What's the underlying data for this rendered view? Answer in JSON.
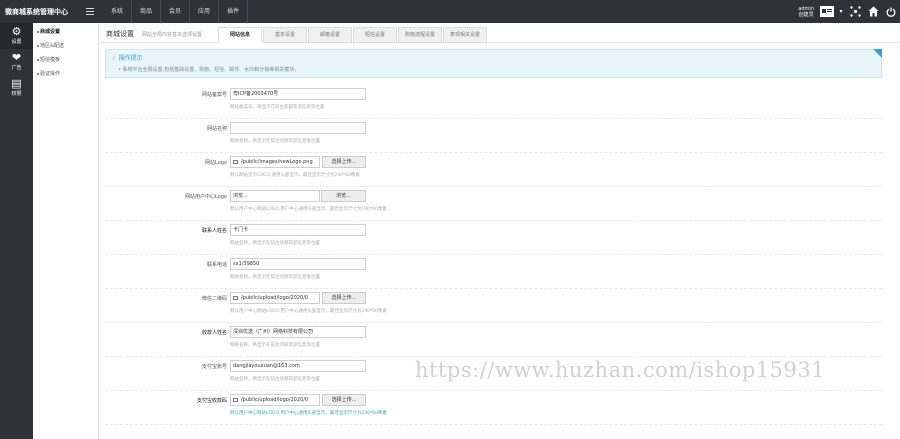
{
  "app": {
    "title": "微商城系统管理中心"
  },
  "topnav": [
    "系统",
    "商品",
    "会员",
    "应用",
    "插件"
  ],
  "user": {
    "name": "admin",
    "role": "创建员"
  },
  "sidebar": [
    {
      "label": "设置",
      "icon": "gear-icon"
    },
    {
      "label": "广告",
      "icon": "heart-icon"
    },
    {
      "label": "权限",
      "icon": "monitor-icon"
    }
  ],
  "subsidebar": [
    "商城设置",
    "地区&配送",
    "短信模板",
    "验证操作"
  ],
  "page": {
    "title": "商城设置",
    "subtitle": "网站全局内容基本选项设置"
  },
  "tabs": [
    "网站信息",
    "基本设置",
    "邮箱设置",
    "短信设置",
    "购物流程设置",
    "表现相关设置"
  ],
  "tip": {
    "title": "操作提示",
    "text": "• 系统平台全局设置,包括基础设置、购物、短信、邮件、水印和分销等相关模块。"
  },
  "form": [
    {
      "label": "网站备案号",
      "value": "粤ICP备2003470号",
      "help": "网站备案号，将显示在前台底部欢迎信息等位置"
    },
    {
      "label": "网站名称",
      "value": "",
      "help": "网站名称，将显示在前台顶部欢迎信息等位置"
    },
    {
      "label": "网站Logo",
      "value": "/public/images/newLogo.png",
      "button": "选择上传...",
      "help": "默认网站首页LOGO,通用头部显示，最佳显示尺寸为240*60像素"
    },
    {
      "label": "网站用户中心Logo",
      "value": "浏览...",
      "button": "浏览...",
      "help": "默认用户中心网站LOGO,用户中心通用头部显示，最佳显示尺寸为180*60像素"
    },
    {
      "label": "联系人姓名",
      "value": "卡门卡",
      "help": "网站名称，将显示在前台顶部欢迎信息等位置"
    },
    {
      "label": "联系电话",
      "value": "sx1/39850",
      "help": "网站名称，将显示在前台顶部欢迎信息等位置"
    },
    {
      "label": "微信二维码",
      "value": "/public/upload/logo/2020/0",
      "button": "选择上传...",
      "help": "默认用户中心网站LOGO,用户中心通用头部显示，最佳显示尺寸为240*60像素"
    },
    {
      "label": "收款人姓名",
      "value": "深圳优选（广州）网络科技有限公司",
      "help": "网站名称，将显示在前台顶部欢迎信息等位置"
    },
    {
      "label": "支付宝账号",
      "value": "dangjiayouxuan@163.com",
      "help": "网站名称，将显示在前台顶部欢迎信息等位置"
    },
    {
      "label": "支付宝收款码",
      "value": "/public/upload/logo/2020/0",
      "button": "选择上传...",
      "help": "默认用户中心网站LOGO,用户中心通用头部显示，最佳显示尺寸为240*60像素"
    }
  ],
  "watermark": "https://www.huzhan.com/ishop15931"
}
